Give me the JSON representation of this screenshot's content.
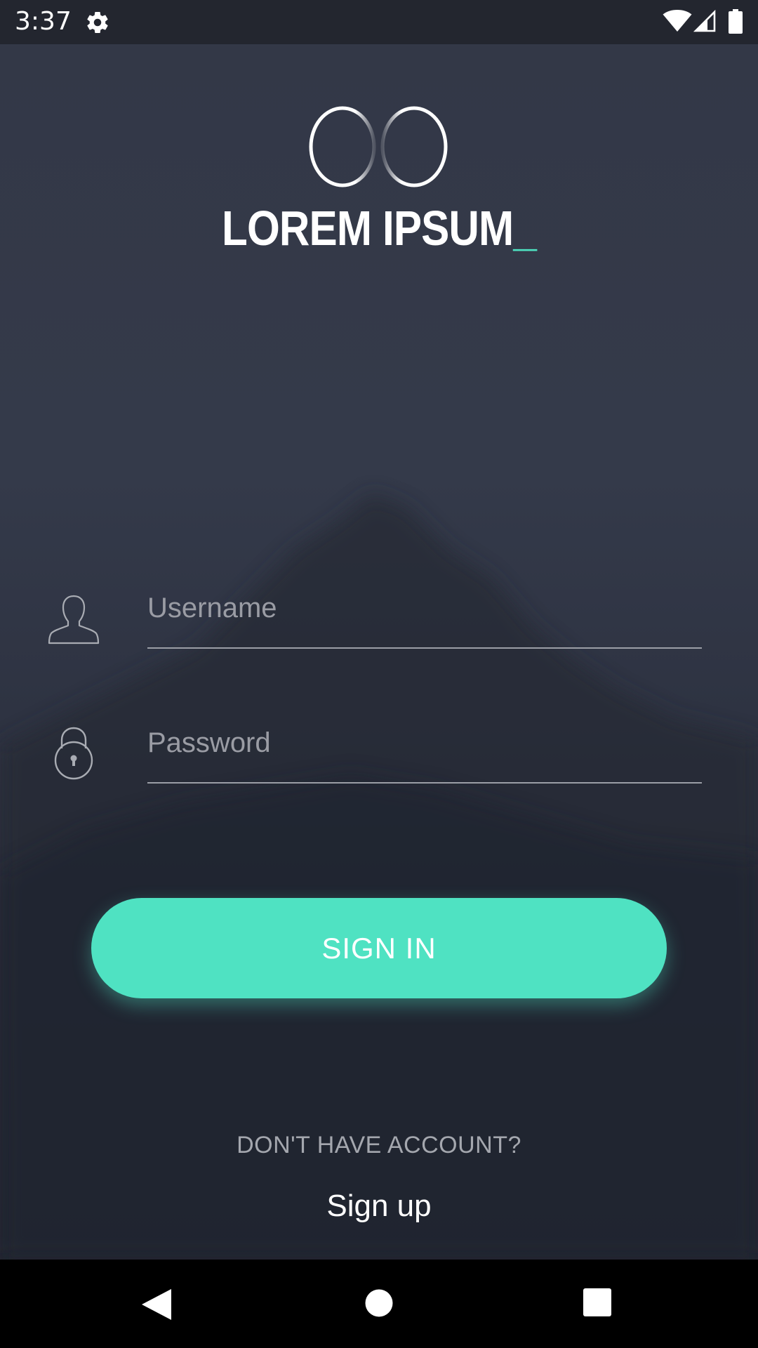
{
  "status_bar": {
    "time": "3:37",
    "icons": [
      "settings-gear-icon",
      "wifi-icon",
      "cell-signal-icon",
      "battery-icon"
    ]
  },
  "logo": {
    "title": "LOREM IPSUM",
    "cursor": "_",
    "icon": "infinity-rings-logo"
  },
  "form": {
    "username": {
      "placeholder": "Username",
      "value": "",
      "icon": "user-silhouette-icon"
    },
    "password": {
      "placeholder": "Password",
      "value": "",
      "icon": "padlock-icon"
    },
    "sign_in_label": "SIGN IN"
  },
  "signup": {
    "prompt": "DON'T HAVE ACCOUNT?",
    "link_label": "Sign up"
  },
  "nav_bar": {
    "icons": [
      "back-triangle-icon",
      "home-circle-icon",
      "recents-square-icon"
    ]
  },
  "colors": {
    "accent": "#4fe2c2",
    "background": "#333847",
    "status_bar": "#23262f",
    "nav_bar": "#000000",
    "text_primary": "#ffffff",
    "text_muted": "#a4a7ae"
  }
}
